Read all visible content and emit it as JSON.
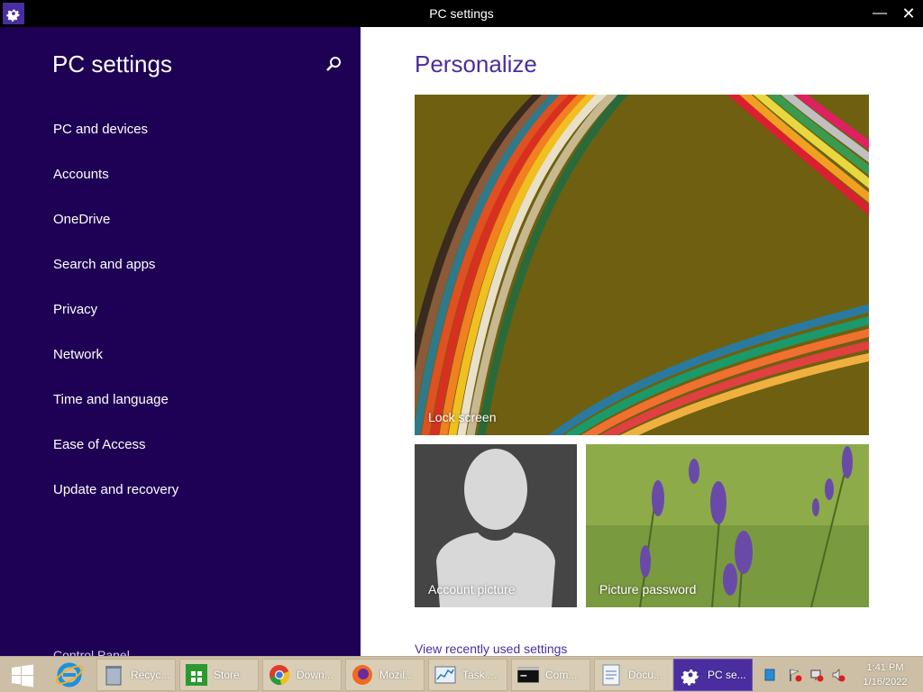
{
  "window": {
    "title": "PC settings",
    "minimize_label": "—",
    "close_label": "✕"
  },
  "sidebar": {
    "title": "PC settings",
    "items": [
      {
        "label": "PC and devices"
      },
      {
        "label": "Accounts"
      },
      {
        "label": "OneDrive"
      },
      {
        "label": "Search and apps"
      },
      {
        "label": "Privacy"
      },
      {
        "label": "Network"
      },
      {
        "label": "Time and language"
      },
      {
        "label": "Ease of Access"
      },
      {
        "label": "Update and recovery"
      }
    ],
    "control_panel": "Control Panel"
  },
  "main": {
    "title": "Personalize",
    "tiles": {
      "lock_screen": "Lock screen",
      "account_picture": "Account picture",
      "picture_password": "Picture password"
    },
    "recent_link": "View recently used settings"
  },
  "taskbar": {
    "items": [
      {
        "label": "Recyc...",
        "icon": "recycle-bin-icon"
      },
      {
        "label": "Store",
        "icon": "store-icon"
      },
      {
        "label": "Down...",
        "icon": "chrome-icon"
      },
      {
        "label": "Mozil...",
        "icon": "firefox-icon"
      },
      {
        "label": "Task ...",
        "icon": "task-manager-icon"
      },
      {
        "label": "Com...",
        "icon": "command-prompt-icon"
      },
      {
        "label": "Docu...",
        "icon": "document-icon"
      },
      {
        "label": "PC se...",
        "icon": "gear-icon"
      }
    ],
    "clock": {
      "time": "1:41 PM",
      "date": "1/16/2022"
    }
  },
  "colors": {
    "sidebar_bg": "#1e0054",
    "accent": "#4a2ea0",
    "taskbar_bg": "#cdbfa6"
  }
}
